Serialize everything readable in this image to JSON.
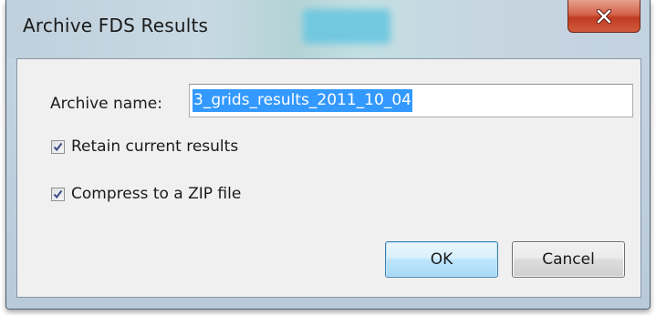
{
  "window": {
    "title": "Archive FDS Results"
  },
  "form": {
    "archive_label": "Archive name:",
    "archive_value": "3_grids_results_2011_10_04",
    "retain_label": "Retain current results",
    "retain_checked": true,
    "compress_label": "Compress to a ZIP file",
    "compress_checked": true
  },
  "buttons": {
    "ok_label": "OK",
    "cancel_label": "Cancel"
  },
  "icons": {
    "close": "close-icon",
    "checkmark": "checkmark-icon"
  },
  "colors": {
    "selection": "#3399ff",
    "close_button": "#c8452b",
    "ok_border": "#3c7fb1"
  }
}
